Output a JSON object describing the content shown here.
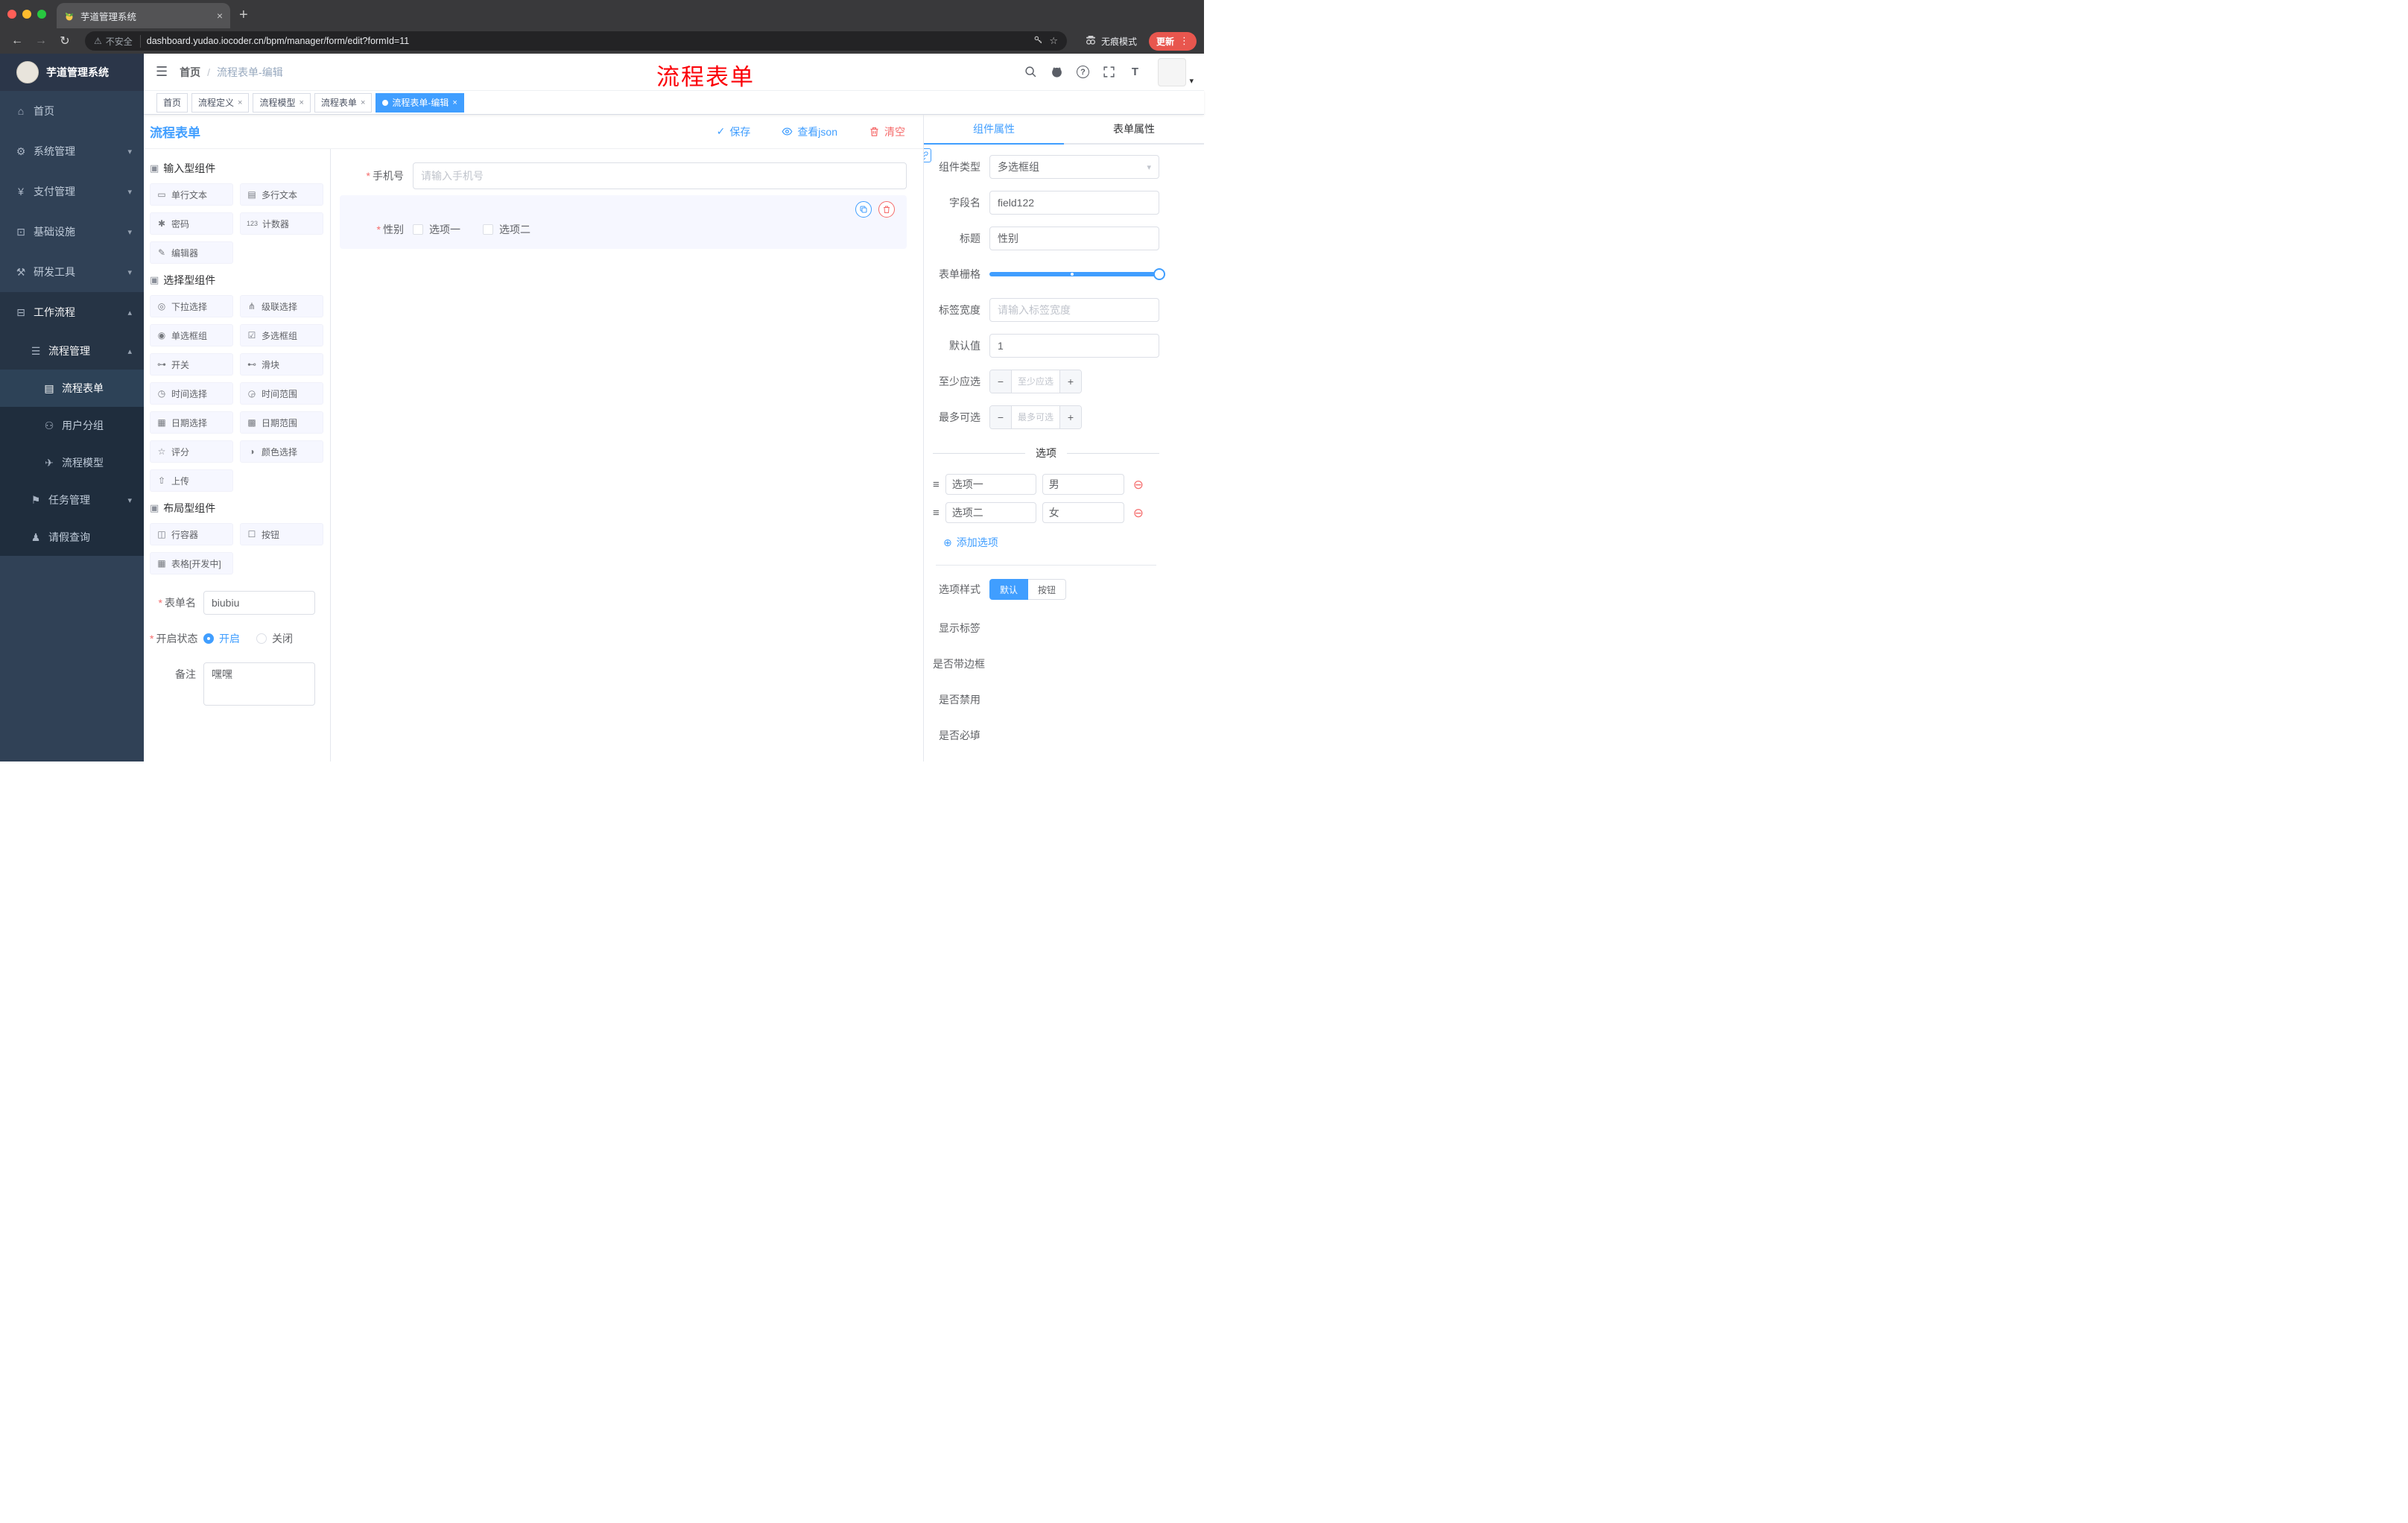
{
  "colors": {
    "primary": "#409EFF",
    "danger": "#F56C6C",
    "annotation": "#FB0007",
    "sidebar_bg": "#304156"
  },
  "browser": {
    "tab_title": "芋道管理系统",
    "security_label": "不安全",
    "url": "dashboard.yudao.iocoder.cn/bpm/manager/form/edit?formId=11",
    "incognito_label": "无痕模式",
    "update_label": "更新",
    "menu_dots": "⋮",
    "back": "←",
    "forward": "→",
    "reload": "↻",
    "warning": "⚠",
    "star": "☆",
    "newtab": "+",
    "close": "×"
  },
  "sidebar": {
    "logo_title": "芋道管理系统",
    "items": [
      {
        "label": "首页",
        "icon": "⌂"
      },
      {
        "label": "系统管理",
        "icon": "⚙",
        "chevron": "▾"
      },
      {
        "label": "支付管理",
        "icon": "¥",
        "chevron": "▾"
      },
      {
        "label": "基础设施",
        "icon": "⊡",
        "chevron": "▾"
      },
      {
        "label": "研发工具",
        "icon": "⚒",
        "chevron": "▾"
      },
      {
        "label": "工作流程",
        "icon": "⊟",
        "chevron": "▴"
      },
      {
        "label": "流程管理",
        "icon": "☰",
        "chevron": "▴"
      },
      {
        "label": "流程表单",
        "icon": "▤"
      },
      {
        "label": "用户分组",
        "icon": "⚇"
      },
      {
        "label": "流程模型",
        "icon": "✈"
      },
      {
        "label": "任务管理",
        "icon": "⚑",
        "chevron": "▾"
      },
      {
        "label": "请假查询",
        "icon": "♟"
      }
    ]
  },
  "header": {
    "hamburger": "☰",
    "breadcrumb": {
      "home": "首页",
      "sep": "/",
      "current": "流程表单-编辑"
    },
    "annotation": "流程表单",
    "question_mark": "?",
    "font_size_icon": "T",
    "avatar_caret": "▾"
  },
  "tags": [
    {
      "label": "首页"
    },
    {
      "label": "流程定义",
      "close": "×"
    },
    {
      "label": "流程模型",
      "close": "×"
    },
    {
      "label": "流程表单",
      "close": "×"
    },
    {
      "label": "流程表单-编辑",
      "close": "×"
    }
  ],
  "action_bar": {
    "title": "流程表单",
    "save_label": "保存",
    "save_check": "✓",
    "view_json_label": "查看json",
    "clear_label": "清空"
  },
  "components_panel": {
    "sections": [
      {
        "icon": "▣",
        "title": "输入型组件",
        "items": [
          {
            "icon": "▭",
            "label": "单行文本"
          },
          {
            "icon": "▤",
            "label": "多行文本"
          },
          {
            "icon": "✱",
            "label": "密码"
          },
          {
            "icon": "123",
            "label": "计数器"
          },
          {
            "icon": "✎",
            "label": "编辑器"
          }
        ]
      },
      {
        "icon": "▣",
        "title": "选择型组件",
        "items": [
          {
            "icon": "◎",
            "label": "下拉选择"
          },
          {
            "icon": "⋔",
            "label": "级联选择"
          },
          {
            "icon": "◉",
            "label": "单选框组"
          },
          {
            "icon": "☑",
            "label": "多选框组"
          },
          {
            "icon": "⊶",
            "label": "开关"
          },
          {
            "icon": "⊷",
            "label": "滑块"
          },
          {
            "icon": "◷",
            "label": "时间选择"
          },
          {
            "icon": "◶",
            "label": "时间范围"
          },
          {
            "icon": "▦",
            "label": "日期选择"
          },
          {
            "icon": "▩",
            "label": "日期范围"
          },
          {
            "icon": "☆",
            "label": "评分"
          },
          {
            "icon": "◑",
            "label": "颜色选择"
          },
          {
            "icon": "⇧",
            "label": "上传"
          }
        ]
      },
      {
        "icon": "▣",
        "title": "布局型组件",
        "items": [
          {
            "icon": "◫",
            "label": "行容器"
          },
          {
            "icon": "☐",
            "label": "按钮"
          },
          {
            "icon": "▦",
            "label": "表格[开发中]"
          }
        ]
      }
    ],
    "meta_form": {
      "form_name_label": "表单名",
      "form_name_value": "biubiu",
      "status_label": "开启状态",
      "status_on": "开启",
      "status_off": "关闭",
      "remark_label": "备注",
      "remark_value": "嘿嘿"
    }
  },
  "canvas": {
    "phone_field": {
      "label": "手机号",
      "placeholder": "请输入手机号"
    },
    "gender_field": {
      "label": "性别",
      "option1": "选项一",
      "option2": "选项二"
    }
  },
  "props_panel": {
    "tabs": {
      "component": "组件属性",
      "form": "表单属性"
    },
    "fields": {
      "component_type_label": "组件类型",
      "component_type_value": "多选框组",
      "select_caret": "▾",
      "field_name_label": "字段名",
      "field_name_value": "field122",
      "title_label": "标题",
      "title_value": "性别",
      "grid_label": "表单栅格",
      "label_width_label": "标签宽度",
      "label_width_placeholder": "请输入标签宽度",
      "default_label": "默认值",
      "default_value": "1",
      "min_label": "至少应选",
      "min_placeholder": "至少应选",
      "max_label": "最多可选",
      "max_placeholder": "最多可选",
      "minus": "−",
      "plus": "+"
    },
    "options_divider": "选项",
    "options": [
      {
        "name": "选项一",
        "value": "男"
      },
      {
        "name": "选项二",
        "value": "女"
      }
    ],
    "drag_icon": "≡",
    "remove_icon": "⊖",
    "add_option_icon": "⊕",
    "add_option_label": "添加选项",
    "style_label": "选项样式",
    "style_default": "默认",
    "style_button": "按钮",
    "switches": [
      {
        "label": "显示标签",
        "on": true
      },
      {
        "label": "是否带边框",
        "on": false
      },
      {
        "label": "是否禁用",
        "on": false
      },
      {
        "label": "是否必填",
        "on": true
      }
    ]
  }
}
